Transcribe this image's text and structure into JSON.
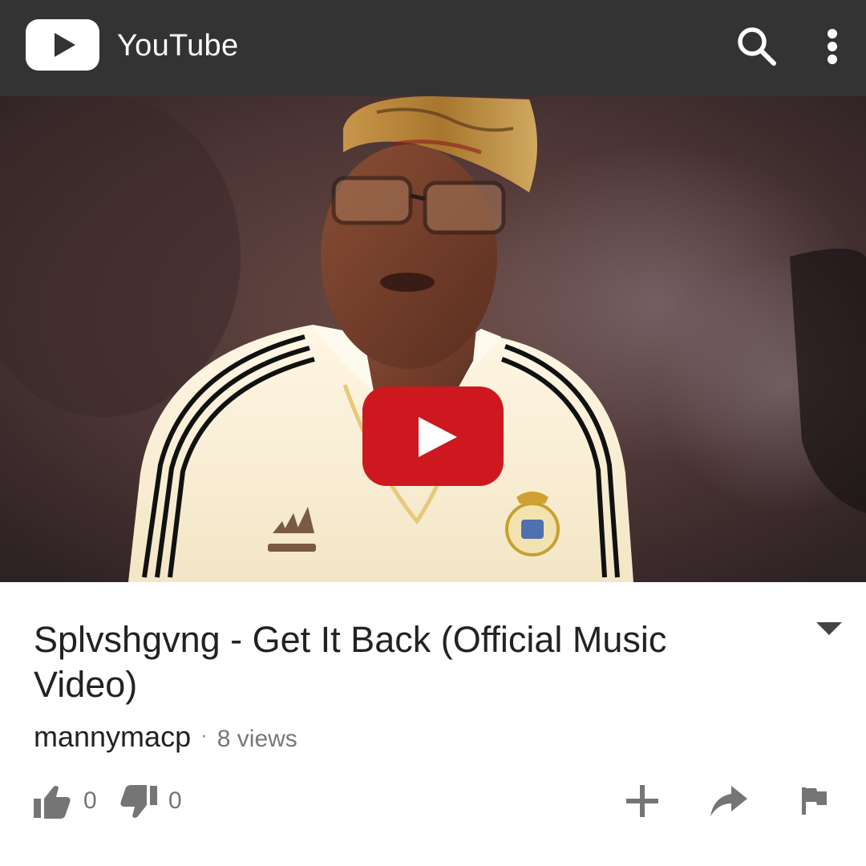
{
  "app_bar": {
    "title": "YouTube",
    "logo_icon": "youtube-logo-icon",
    "search_icon": "search-icon",
    "more_icon": "more-vert-icon"
  },
  "player": {
    "play_icon": "play-icon",
    "play_color": "#cc181e"
  },
  "video": {
    "title": "Splvshgvng - Get It Back (Official Music Video)",
    "channel": "mannymacp",
    "separator": "·",
    "views": "8 views"
  },
  "actions": {
    "likes": "0",
    "dislikes": "0",
    "like_icon": "thumbs-up-icon",
    "dislike_icon": "thumbs-down-icon",
    "add_icon": "add-to-playlist-icon",
    "share_icon": "share-icon",
    "flag_icon": "flag-icon"
  },
  "colors": {
    "app_bar": "#333333",
    "text_primary": "#222222",
    "text_secondary": "#777777",
    "icon_gray": "#757575"
  }
}
